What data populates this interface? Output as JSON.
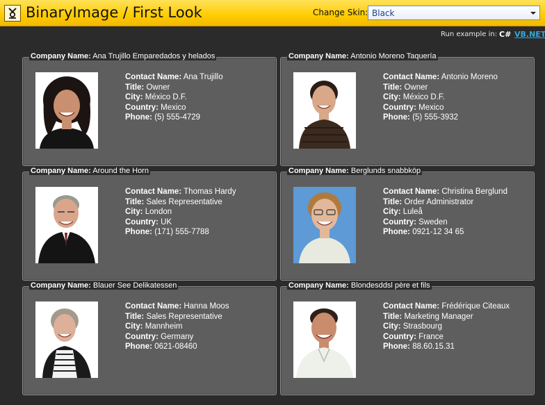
{
  "header": {
    "title": "BinaryImage / First Look",
    "skin_label": "Change Skin:",
    "skin_value": "Black",
    "run_label": "Run example in:",
    "lang_cs": "C#",
    "lang_vb": "VB.NET"
  },
  "labels": {
    "company": "Company Name:",
    "contact": "Contact Name:",
    "title": "Title:",
    "city": "City:",
    "country": "Country:",
    "phone": "Phone:"
  },
  "cards": [
    {
      "company": "Ana Trujillo Emparedados y helados",
      "contact": "Ana Trujillo",
      "title": "Owner",
      "city": "México D.F.",
      "country": "Mexico",
      "phone": "(5) 555-4729"
    },
    {
      "company": "Antonio Moreno Taquería",
      "contact": "Antonio Moreno",
      "title": "Owner",
      "city": "México D.F.",
      "country": "Mexico",
      "phone": "(5) 555-3932"
    },
    {
      "company": "Around the Horn",
      "contact": "Thomas Hardy",
      "title": "Sales Representative",
      "city": "London",
      "country": "UK",
      "phone": "(171) 555-7788"
    },
    {
      "company": "Berglunds snabbköp",
      "contact": "Christina Berglund",
      "title": "Order Administrator",
      "city": "Luleå",
      "country": "Sweden",
      "phone": "0921-12 34 65"
    },
    {
      "company": "Blauer See Delikatessen",
      "contact": "Hanna Moos",
      "title": "Sales Representative",
      "city": "Mannheim",
      "country": "Germany",
      "phone": "0621-08460"
    },
    {
      "company": "Blondesddsl père et fils",
      "contact": "Frédérique Citeaux",
      "title": "Marketing Manager",
      "city": "Strasbourg",
      "country": "France",
      "phone": "88.60.15.31"
    }
  ],
  "colors": {
    "header_yellow": "#ffcc00",
    "page_bg": "#2b2b2b",
    "card_bg": "#5e5e5e",
    "link_blue": "#36a6d6"
  }
}
